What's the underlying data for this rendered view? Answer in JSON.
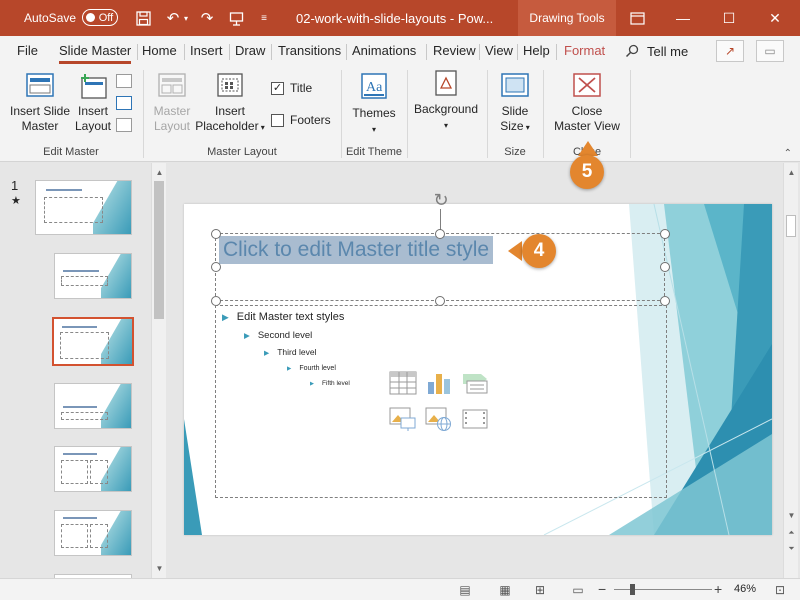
{
  "titlebar": {
    "autosave_label": "AutoSave",
    "autosave_state": "Off",
    "doc_title": "02-work-with-slide-layouts  -  Pow...",
    "context_tab": "Drawing Tools",
    "accent": "#b7472a"
  },
  "tabs": [
    {
      "label": "File"
    },
    {
      "label": "Slide Master"
    },
    {
      "label": "Home"
    },
    {
      "label": "Insert"
    },
    {
      "label": "Draw"
    },
    {
      "label": "Transitions"
    },
    {
      "label": "Animations"
    },
    {
      "label": "Review"
    },
    {
      "label": "View"
    },
    {
      "label": "Help"
    },
    {
      "label": "Format"
    }
  ],
  "tell_me": "Tell me",
  "ribbon": {
    "edit_master": {
      "insert_slide_master": [
        "Insert Slide",
        "Master"
      ],
      "insert_layout": [
        "Insert",
        "Layout"
      ],
      "label": "Edit Master"
    },
    "master_layout": {
      "master_layout": [
        "Master",
        "Layout"
      ],
      "insert_placeholder": [
        "Insert",
        "Placeholder"
      ],
      "title_check": "Title",
      "footers_check": "Footers",
      "label": "Master Layout"
    },
    "edit_theme": {
      "themes": "Themes",
      "background": "Background",
      "label": "Edit Theme"
    },
    "size": {
      "slide_size": [
        "Slide",
        "Size"
      ],
      "label": "Size"
    },
    "close": {
      "close_master_view": [
        "Close",
        "Master View"
      ],
      "label": "Close"
    }
  },
  "thumbs": {
    "slide_number": "1",
    "star": "★"
  },
  "slide": {
    "title": "Click to edit Master title style",
    "levels": [
      "Edit Master text styles",
      "Second level",
      "Third level",
      "Fourth level",
      "Fifth level"
    ]
  },
  "callouts": {
    "step4": "4",
    "step5": "5",
    "color": "#e3862e"
  },
  "statusbar": {
    "zoom_minus": "−",
    "zoom_plus": "+",
    "zoom": "46%",
    "zoom_value": 0.46
  }
}
